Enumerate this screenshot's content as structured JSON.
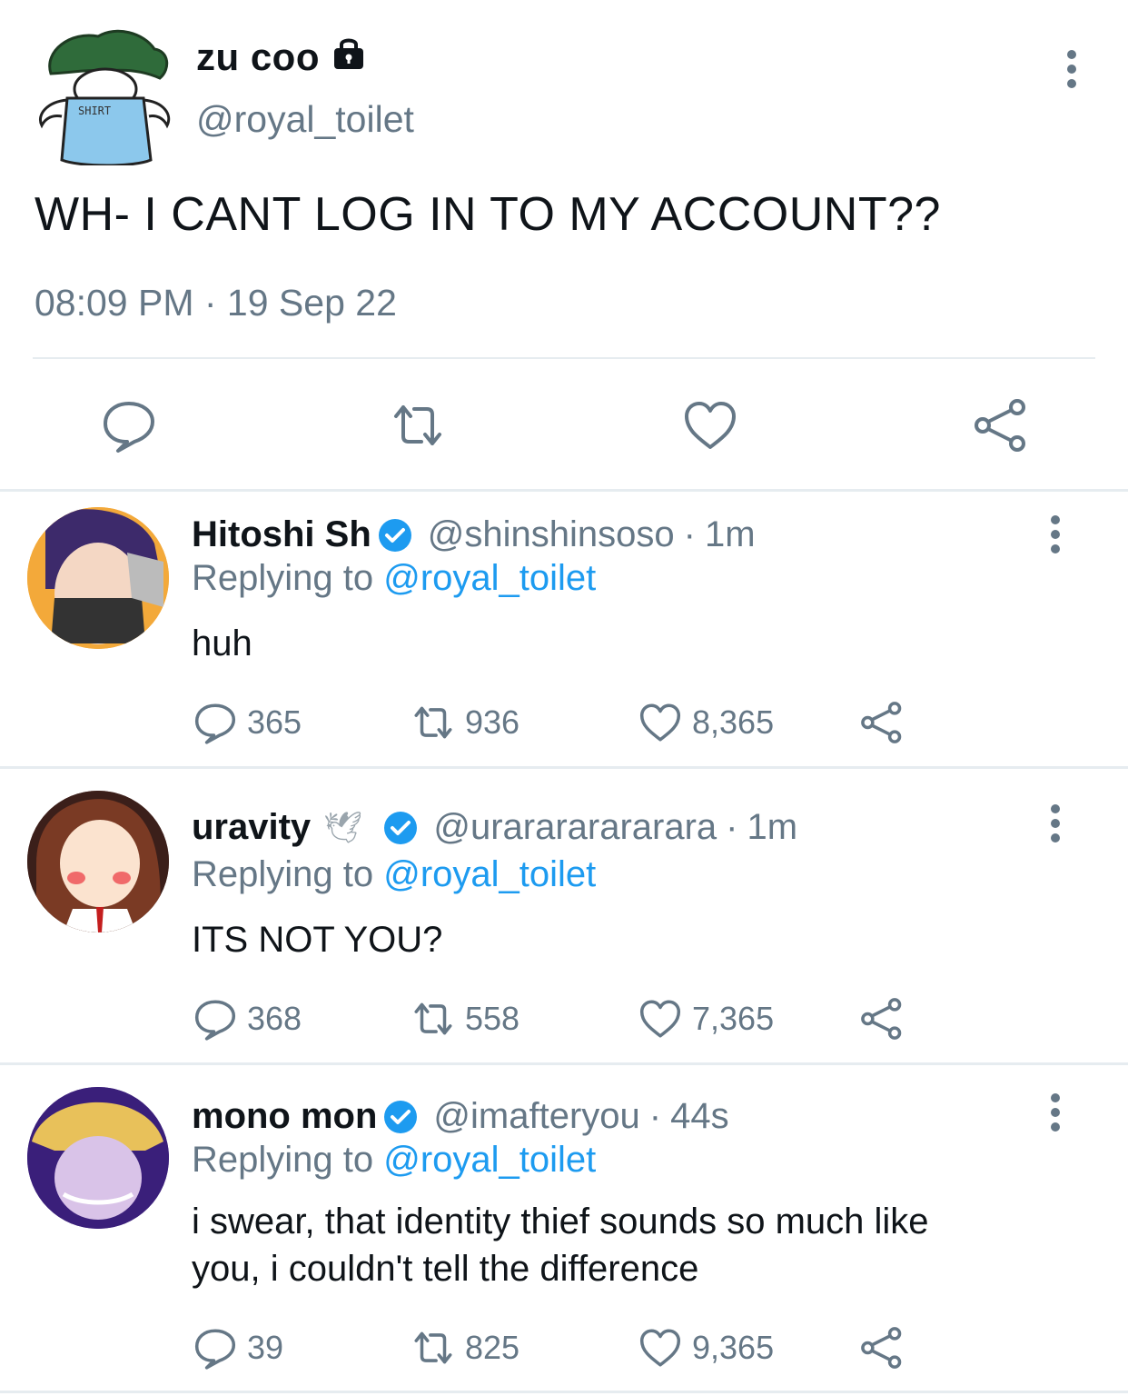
{
  "main_tweet": {
    "display_name": "zu coo",
    "locked_icon": "lock-icon",
    "handle": "@royal_toilet",
    "text": "WH- I CANT LOG IN TO MY ACCOUNT??",
    "timestamp": "08:09 PM · 19 Sep 22",
    "avatar_shirt_text": "SHIRT",
    "actions": [
      "reply-icon",
      "retweet-icon",
      "like-icon",
      "share-icon"
    ]
  },
  "replies": [
    {
      "display_name": "Hitoshi Sh",
      "verified": true,
      "handle": "@shinshinsoso",
      "time": "1m",
      "replying_label": "Replying to",
      "replying_handle": "@royal_toilet",
      "text": "huh",
      "replies_count": "365",
      "retweets_count": "936",
      "likes_count": "8,365"
    },
    {
      "display_name": "uravity",
      "emoji": "🕊",
      "verified": true,
      "handle": "@urarararararara",
      "time": "1m",
      "replying_label": "Replying to",
      "replying_handle": "@royal_toilet",
      "text": "ITS NOT YOU?",
      "replies_count": "368",
      "retweets_count": "558",
      "likes_count": "7,365"
    },
    {
      "display_name": "mono mon",
      "verified": true,
      "handle": "@imafteryou",
      "time": "44s",
      "replying_label": "Replying to",
      "replying_handle": "@royal_toilet",
      "text_line1": "i swear, that identity thief sounds so much like",
      "text_line2": "you, i couldn't tell the difference",
      "replies_count": "39",
      "retweets_count": "825",
      "likes_count": "9,365"
    }
  ],
  "colors": {
    "accent": "#1d9bf0",
    "muted": "#657786",
    "divider": "#e6ecf0"
  }
}
